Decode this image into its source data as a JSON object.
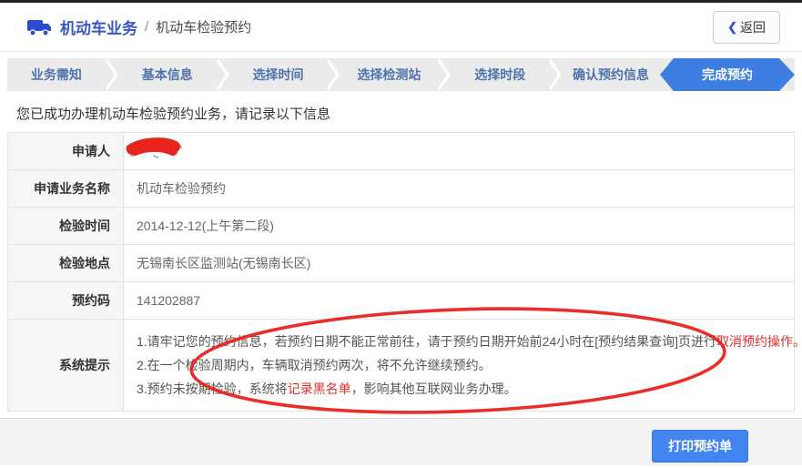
{
  "header": {
    "title": "机动车业务",
    "divider": "/",
    "subtitle": "机动车检验预约",
    "back": {
      "chevron": "❮",
      "label": "返回"
    }
  },
  "steps": [
    {
      "label": "业务需知",
      "active": false
    },
    {
      "label": "基本信息",
      "active": false
    },
    {
      "label": "选择时间",
      "active": false
    },
    {
      "label": "选择检测站",
      "active": false
    },
    {
      "label": "选择时段",
      "active": false
    },
    {
      "label": "确认预约信息",
      "active": false
    },
    {
      "label": "完成预约",
      "active": true
    }
  ],
  "success_message": "您已成功办理机动车检验预约业务，请记录以下信息",
  "table": {
    "applicant": {
      "label": "申请人",
      "value": "",
      "note": "value-redacted-with-red-marker"
    },
    "service_name": {
      "label": "申请业务名称",
      "value": "机动车检验预约"
    },
    "inspection_time": {
      "label": "检验时间",
      "value": "2014-12-12(上午第二段)"
    },
    "inspection_place": {
      "label": "检验地点",
      "value": "无锡南长区监测站(无锡南长区)"
    },
    "booking_code": {
      "label": "预约码",
      "value": "141202887"
    },
    "system_tips": {
      "label": "系统提示",
      "line1_normal": "1.请牢记您的预约信息，若预约日期不能正常前往，请于预约日期开始前24小时在[预约结果查询]页进行",
      "line1_red": "取消预约操作。",
      "line2": "2.在一个检验周期内，车辆取消预约两次，将不允许继续预约。",
      "line3_normal_a": "3.预约未按期检验，系统将",
      "line3_red": "记录黑名单",
      "line3_normal_b": "，影响其他互联网业务办理。"
    }
  },
  "footer": {
    "print_button": "打印预约单"
  },
  "colors": {
    "topline": "#23262d",
    "title_blue": "#3b57c4",
    "step_text_blue": "#4e73ad",
    "active_step_blue": "#3d7ee0",
    "button_blue": "#4285f0",
    "red_text": "#dc2f2b",
    "annotation_red": "#e8221c",
    "label_cell_bg": "#f6f6f6",
    "step_bar_bg": "#ebebeb",
    "footer_bg": "#f3f3f3"
  }
}
